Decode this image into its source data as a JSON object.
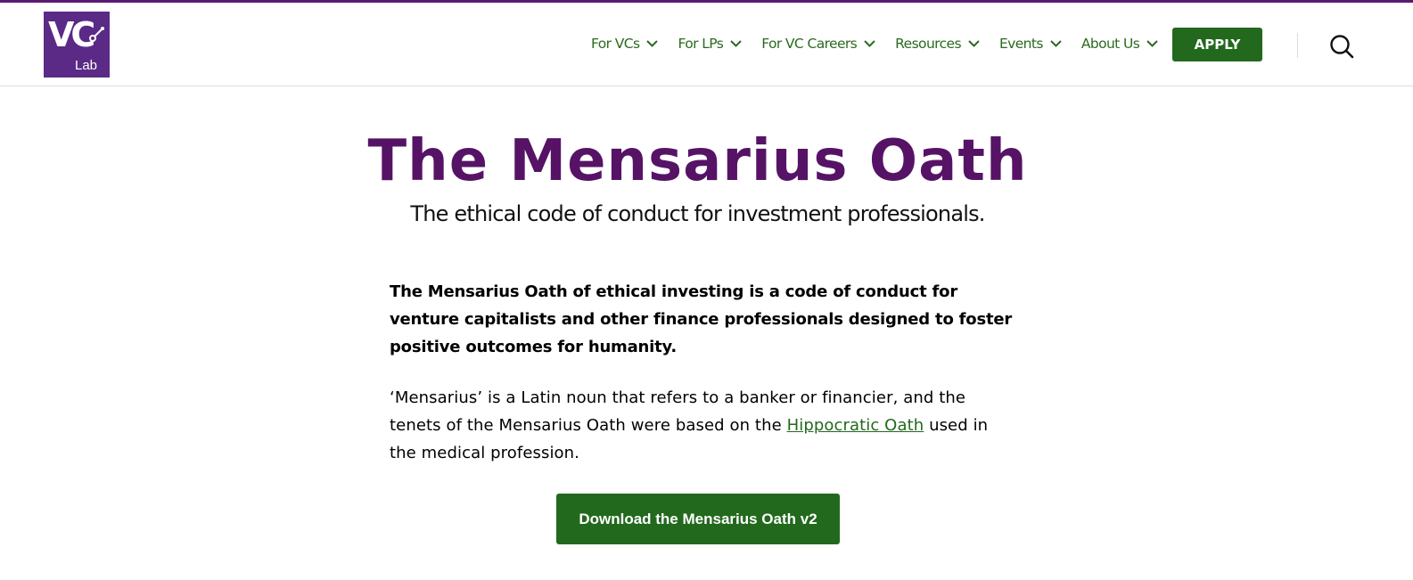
{
  "header": {
    "logo": {
      "main": "VC",
      "sub": "Lab"
    },
    "nav": [
      {
        "label": "For VCs"
      },
      {
        "label": "For LPs"
      },
      {
        "label": "For VC Careers"
      },
      {
        "label": "Resources"
      },
      {
        "label": "Events"
      },
      {
        "label": "About Us"
      }
    ],
    "apply_label": "APPLY",
    "search_icon": "search-icon"
  },
  "main": {
    "title": "The Mensarius Oath",
    "subtitle": "The ethical code of conduct for investment professionals.",
    "lead": "The Mensarius Oath of ethical investing is a code of conduct for venture capitalists and other finance professionals designed to foster positive outcomes for humanity.",
    "para_before": "‘Mensarius’ is a Latin noun that refers to a banker or financier, and the tenets of the Mensarius Oath were based on the ",
    "para_link": "Hippocratic Oath",
    "para_after": " used in the medical profession.",
    "download_label": "Download the Mensarius Oath v2"
  },
  "colors": {
    "brand_purple": "#561366",
    "brand_green": "#22691d",
    "nav_green": "#2a6a1e"
  }
}
